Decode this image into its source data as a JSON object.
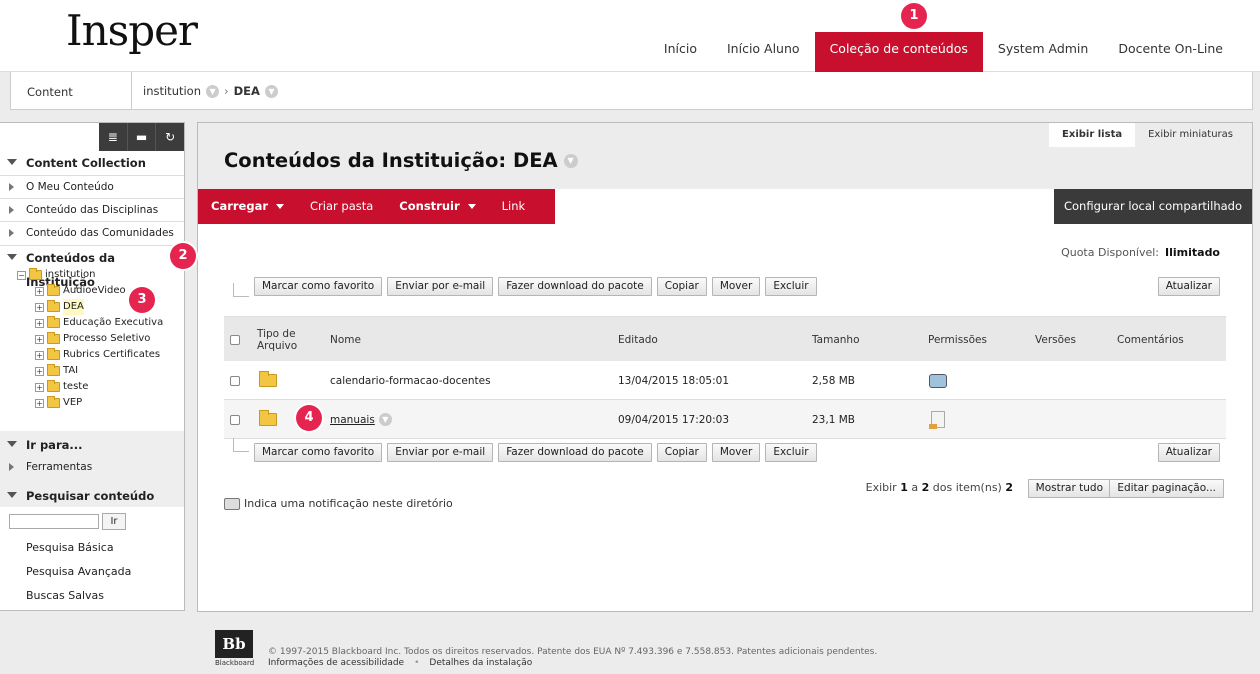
{
  "logo": "Insper",
  "tabs": [
    "Início",
    "Início Aluno",
    "Coleção de conteúdos",
    "System Admin",
    "Docente On-Line"
  ],
  "breadcrumb": {
    "root": "Content Collection",
    "path1": "institution",
    "sep": "›",
    "path2": "DEA"
  },
  "leftnav": {
    "tools": [
      "≣",
      "▬",
      "↻"
    ],
    "section_cc": "Content Collection",
    "items_cc": [
      "O Meu Conteúdo",
      "Conteúdo das Disciplinas",
      "Conteúdo das Comunidades"
    ],
    "section_inst": "Conteúdos da Instituição",
    "tree_root": "institution",
    "tree_items": [
      "AudioeVideo",
      "DEA",
      "Educação Executiva",
      "Processo Seletivo",
      "Rubrics Certificates",
      "TAI",
      "teste",
      "VEP"
    ],
    "section_goto": "Ir para...",
    "goto_item": "Ferramentas",
    "section_search": "Pesquisar conteúdo",
    "search_go": "Ir",
    "search_links": [
      "Pesquisa Básica",
      "Pesquisa Avançada",
      "Buscas Salvas"
    ]
  },
  "main": {
    "view_list": "Exibir lista",
    "view_thumbs": "Exibir miniaturas",
    "title": "Conteúdos da Instituição: DEA",
    "actions": [
      "Carregar",
      "Criar pasta",
      "Construir",
      "Link"
    ],
    "config": "Configurar local compartilhado",
    "quota_label": "Quota Disponível:",
    "quota_value": "Ilimitado",
    "buttons": [
      "Marcar como favorito",
      "Enviar por e-mail",
      "Fazer download do pacote",
      "Copiar",
      "Mover",
      "Excluir"
    ],
    "refresh": "Atualizar",
    "columns": [
      "Tipo de Arquivo",
      "Nome",
      "Editado",
      "Tamanho",
      "Permissões",
      "Versões",
      "Comentários"
    ],
    "rows": [
      {
        "name": "calendario-formacao-docentes",
        "edited": "13/04/2015 18:05:01",
        "size": "2,58 MB"
      },
      {
        "name": "manuais",
        "edited": "09/04/2015 17:20:03",
        "size": "23,1 MB"
      }
    ],
    "paging": {
      "prefix": "Exibir",
      "from": "1",
      "a": "a",
      "to": "2",
      "dos": "dos item(ns)",
      "total": "2"
    },
    "show_all": "Mostrar tudo",
    "edit_paging": "Editar paginação...",
    "notice": "Indica uma notificação neste diretório"
  },
  "badges": [
    "1",
    "2",
    "3",
    "4"
  ],
  "footer": {
    "bb_logo": "Bb",
    "bb_caption": "Blackboard",
    "copyright": "© 1997-2015 Blackboard Inc. Todos os direitos reservados. Patente dos EUA Nº 7.493.396 e 7.558.853. Patentes adicionais pendentes.",
    "link1": "Informações de acessibilidade",
    "dot": "•",
    "link2": "Detalhes da instalação"
  },
  "colors": {
    "accent": "#c8102e",
    "badge": "#e52550",
    "dark": "#3a3a3a"
  }
}
